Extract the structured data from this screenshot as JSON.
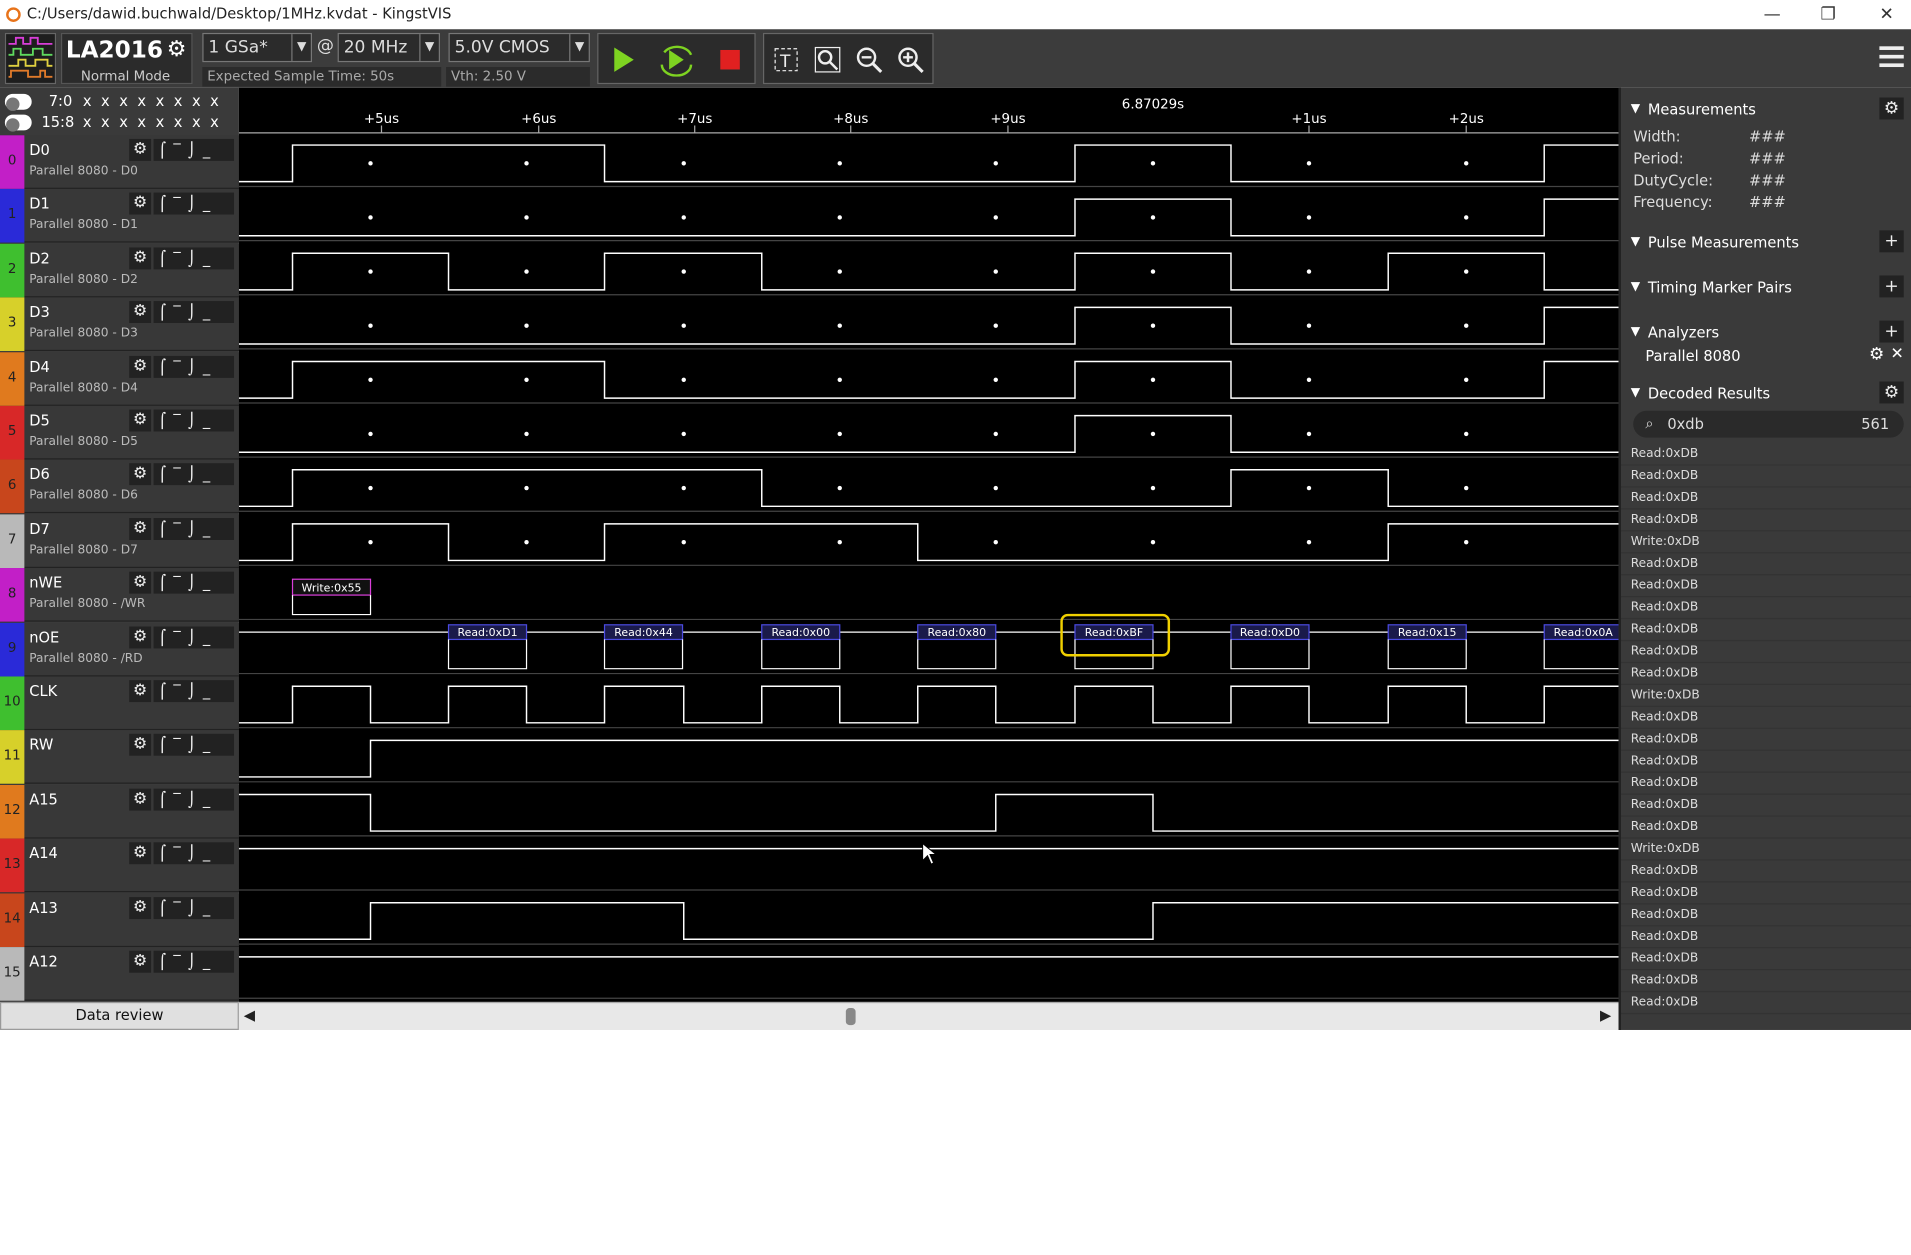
{
  "window": {
    "title": "C:/Users/dawid.buchwald/Desktop/1MHz.kvdat - KingstVIS",
    "minimize": "—",
    "restore": "❐",
    "close": "✕"
  },
  "toolbar": {
    "device": "LA2016",
    "mode": "Normal Mode",
    "sample_rate": "1 GSa*",
    "at": "@",
    "frequency": "20 MHz",
    "voltage": "5.0V CMOS",
    "expected_time": "Expected Sample Time: 50s",
    "vth": "Vth: 2.50 V"
  },
  "groups": [
    {
      "label": "7:0",
      "values": "x x x x x x x x"
    },
    {
      "label": "15:8",
      "values": "x x x x x x x x"
    }
  ],
  "time_labels": [
    "+5us",
    "+6us",
    "+7us",
    "+8us",
    "+9us",
    "6.87029s",
    "+1us",
    "+2us"
  ],
  "channels": [
    {
      "num": "0",
      "name": "D0",
      "desc": "Parallel 8080 - D0",
      "color": "#c21fc7"
    },
    {
      "num": "1",
      "name": "D1",
      "desc": "Parallel 8080 - D1",
      "color": "#2a2ad8"
    },
    {
      "num": "2",
      "name": "D2",
      "desc": "Parallel 8080 - D2",
      "color": "#3fbf2f"
    },
    {
      "num": "3",
      "name": "D3",
      "desc": "Parallel 8080 - D3",
      "color": "#d7d02a"
    },
    {
      "num": "4",
      "name": "D4",
      "desc": "Parallel 8080 - D4",
      "color": "#e07a1e"
    },
    {
      "num": "5",
      "name": "D5",
      "desc": "Parallel 8080 - D5",
      "color": "#d82828"
    },
    {
      "num": "6",
      "name": "D6",
      "desc": "Parallel 8080 - D6",
      "color": "#c8461c"
    },
    {
      "num": "7",
      "name": "D7",
      "desc": "Parallel 8080 - D7",
      "color": "#b9b9b9"
    },
    {
      "num": "8",
      "name": "nWE",
      "desc": "Parallel 8080 - /WR",
      "color": "#c21fc7"
    },
    {
      "num": "9",
      "name": "nOE",
      "desc": "Parallel 8080 - /RD",
      "color": "#2a2ad8"
    },
    {
      "num": "10",
      "name": "CLK",
      "desc": "",
      "color": "#3fbf2f"
    },
    {
      "num": "11",
      "name": "RW",
      "desc": "",
      "color": "#d7d02a"
    },
    {
      "num": "12",
      "name": "A15",
      "desc": "",
      "color": "#e07a1e"
    },
    {
      "num": "13",
      "name": "A14",
      "desc": "",
      "color": "#d82828"
    },
    {
      "num": "14",
      "name": "A13",
      "desc": "",
      "color": "#c8461c"
    },
    {
      "num": "15",
      "name": "A12",
      "desc": "",
      "color": "#b9b9b9"
    }
  ],
  "decoder_labels": {
    "write": "Write:0x55",
    "reads": [
      "Read:0xD1",
      "Read:0x44",
      "Read:0x00",
      "Read:0x80",
      "Read:0xBF",
      "Read:0xD0",
      "Read:0x15",
      "Read:0x0A"
    ]
  },
  "data_review": "Data review",
  "panel": {
    "measurements": {
      "title": "Measurements",
      "rows": [
        {
          "k": "Width:",
          "v": "###"
        },
        {
          "k": "Period:",
          "v": "###"
        },
        {
          "k": "DutyCycle:",
          "v": "###"
        },
        {
          "k": "Frequency:",
          "v": "###"
        }
      ]
    },
    "pulse": "Pulse Measurements",
    "timing": "Timing Marker Pairs",
    "analyzers": "Analyzers",
    "analyzer_item": "Parallel 8080",
    "decoded": "Decoded Results",
    "search_value": "0xdb",
    "search_count": "561",
    "results": [
      "Read:0xDB",
      "Read:0xDB",
      "Read:0xDB",
      "Read:0xDB",
      "Write:0xDB",
      "Read:0xDB",
      "Read:0xDB",
      "Read:0xDB",
      "Read:0xDB",
      "Read:0xDB",
      "Read:0xDB",
      "Write:0xDB",
      "Read:0xDB",
      "Read:0xDB",
      "Read:0xDB",
      "Read:0xDB",
      "Read:0xDB",
      "Read:0xDB",
      "Write:0xDB",
      "Read:0xDB",
      "Read:0xDB",
      "Read:0xDB",
      "Read:0xDB",
      "Read:0xDB",
      "Read:0xDB",
      "Read:0xDB"
    ]
  }
}
